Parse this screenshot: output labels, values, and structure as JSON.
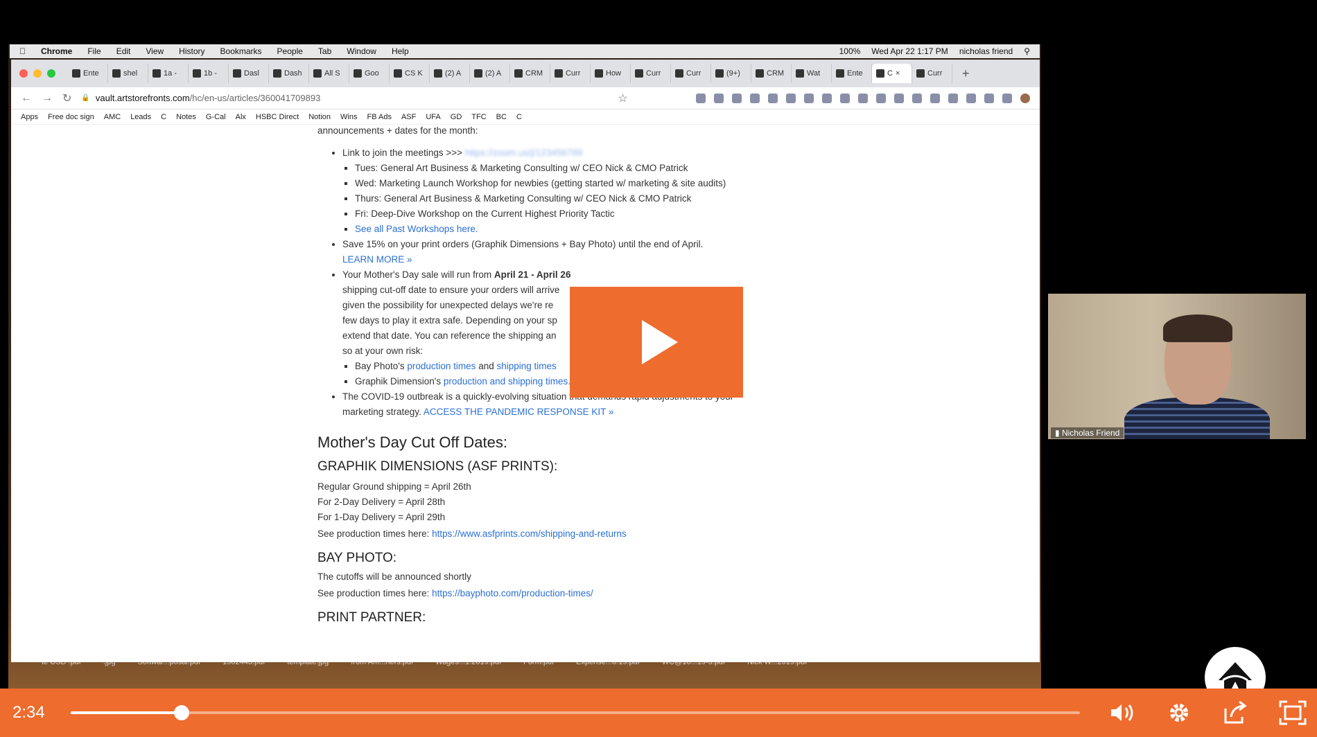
{
  "menubar": {
    "items": [
      "Chrome",
      "File",
      "Edit",
      "View",
      "History",
      "Bookmarks",
      "People",
      "Tab",
      "Window",
      "Help"
    ],
    "battery": "100%",
    "datetime": "Wed Apr 22  1:17 PM",
    "user": "nicholas friend"
  },
  "tabs": [
    "Ente",
    "shel",
    "1a -",
    "1b -",
    "Dasl",
    "Dash",
    "All S",
    "Goo",
    "CS K",
    "(2) A",
    "(2) A",
    "CRM",
    "Curr",
    "How",
    "Curr",
    "Curr",
    "(9+)",
    "CRM",
    "Wat",
    "Ente",
    "C",
    "Curr"
  ],
  "address": {
    "host": "vault.artstorefronts.com",
    "path": "/hc/en-us/articles/360041709893"
  },
  "bookmarks": [
    "Apps",
    "Free doc sign",
    "AMC",
    "Leads",
    "C",
    "Notes",
    "G-Cal",
    "Alx",
    "HSBC Direct",
    "Notion",
    "Wins",
    "FB Ads",
    "ASF",
    "UFA",
    "GD",
    "TFC",
    "BC",
    "C"
  ],
  "article": {
    "intro": "announcements + dates for the month:",
    "meetings_link": "Link to join the meetings >>>",
    "meetings_url_blur": "https://zoom.us/j/123456789",
    "schedule": [
      "Tues:  General Art Business & Marketing Consulting w/ CEO Nick & CMO Patrick",
      "Wed:  Marketing Launch Workshop for newbies (getting started w/ marketing & site audits)",
      "Thurs: General Art Business & Marketing Consulting w/ CEO Nick & CMO Patrick",
      "Fri:  Deep-Dive Workshop on the Current Highest Priority Tactic"
    ],
    "past_workshops": "See all Past Workshops here.",
    "save_text": "Save 15% on your print orders (Graphik Dimensions + Bay Photo) until the end of April.",
    "learn_more": "LEARN MORE »",
    "mothers_pre": "Your Mother's Day sale will run from ",
    "mothers_bold": "April 21 - April 26",
    "mothers_p1": "shipping cut-off date to ensure your orders will arrive",
    "mothers_p2": "given the possibility for unexpected delays we're re",
    "mothers_p3": "few days to play it extra safe. Depending on your sp",
    "mothers_p4": "extend that date. You can reference the shipping an",
    "mothers_p5": "so at your own risk:",
    "bay_pre": "Bay Photo's ",
    "bay_link1": "production times",
    "bay_and": " and ",
    "bay_link2": "shipping times",
    "gd_pre": "Graphik Dimension's ",
    "gd_link": "production and shipping times.",
    "covid_text": "The COVID-19 outbreak is a quickly-evolving situation that demands rapid adjustments to your marketing strategy. ",
    "covid_link": "ACCESS THE PANDEMIC RESPONSE KIT »",
    "cutoff_heading": "Mother's Day Cut Off Dates:",
    "gd_heading": "GRAPHIK DIMENSIONS (ASF PRINTS):",
    "gd_lines": [
      "Regular Ground shipping = April 26th",
      "For 2-Day Delivery = April 28th",
      "For 1-Day Delivery = April 29th"
    ],
    "gd_prod_pre": "See production times here: ",
    "gd_prod_link": "https://www.asfprints.com/shipping-and-returns",
    "bay_heading": "BAY PHOTO:",
    "bay_line": "The cutoffs will be announced shortly",
    "bay_prod_pre": "See production times here: ",
    "bay_prod_link": "https://bayphoto.com/production-times/",
    "partner_heading": "PRINT PARTNER:"
  },
  "desktop_files": [
    "te USD .pdf",
    ".jpg",
    "Softwar...posal.pdf",
    "1502443.pdf",
    "template.jpg",
    "from Am...hers.pdf",
    "Wages...1.2019.pdf",
    "Form.pdf",
    "Expense...0.19.pdf",
    "WC@10...19-3.pdf",
    "Nick W...2019.pdf"
  ],
  "webcam": {
    "name": "Nicholas Friend"
  },
  "player": {
    "time": "2:34",
    "progress": 0.11,
    "accent": "#ee6c2d"
  }
}
